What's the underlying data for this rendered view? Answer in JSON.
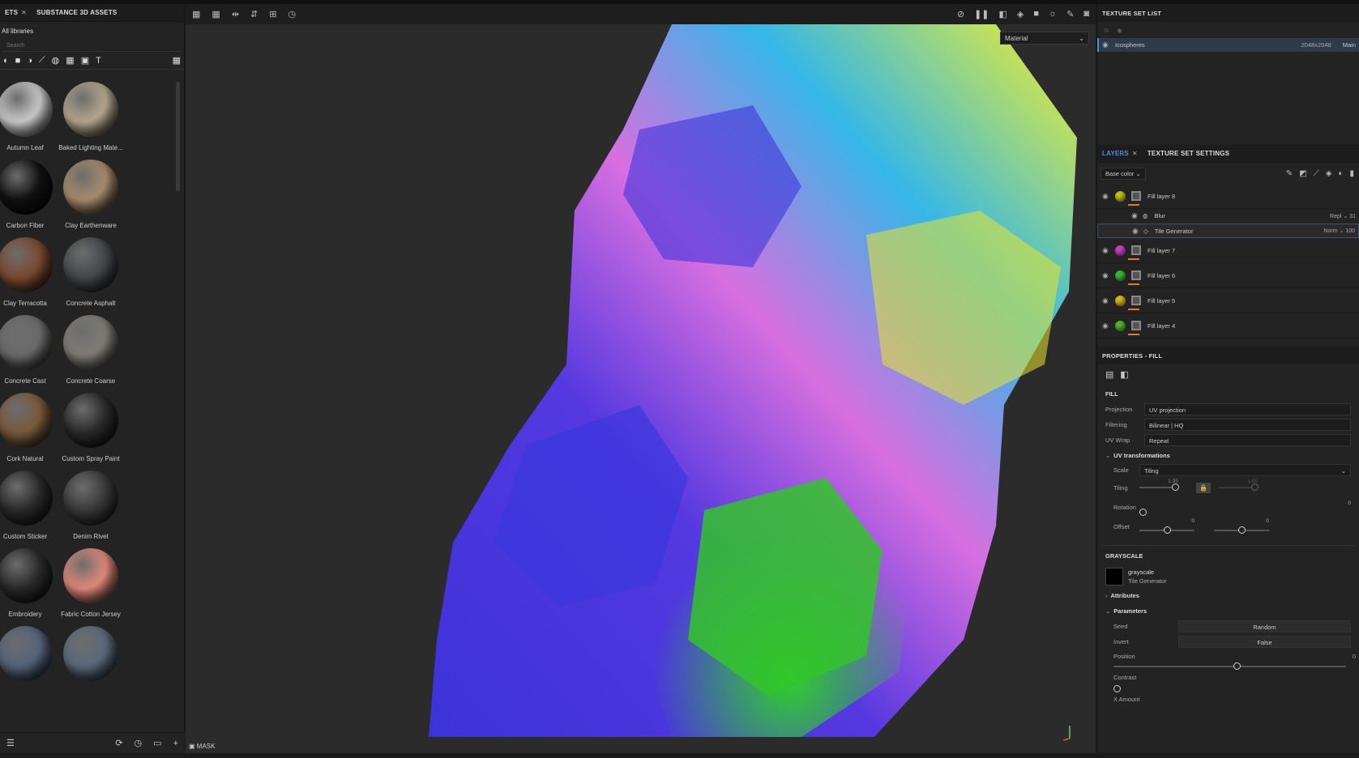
{
  "assets": {
    "tabs": [
      {
        "label": "ETS"
      },
      {
        "label": "SUBSTANCE 3D ASSETS"
      }
    ],
    "library": "All libraries",
    "search_placeholder": "Search",
    "items": [
      {
        "label": "Autumn Leaf",
        "color": "#c9c9c9"
      },
      {
        "label": "Baked Lighting Mate...",
        "color": "#b6a88e"
      },
      {
        "label": "Carbon Fiber",
        "color": "#111111"
      },
      {
        "label": "Clay Earthenware",
        "color": "#a98c6d"
      },
      {
        "label": "Clay Terracotta",
        "color": "#7a4a30"
      },
      {
        "label": "Concrete Asphalt",
        "color": "#45474b"
      },
      {
        "label": "Concrete Cast",
        "color": "#6b6b6b"
      },
      {
        "label": "Concrete Coarse",
        "color": "#7f7d75"
      },
      {
        "label": "Cork Natural",
        "color": "#7a5a3c"
      },
      {
        "label": "Custom Spray Paint",
        "color": "#2a2a2a"
      },
      {
        "label": "Custom Sticker",
        "color": "#2a2a2a"
      },
      {
        "label": "Denim Rivet",
        "color": "#3a3a3a"
      },
      {
        "label": "Embroidery",
        "color": "#2a2a2a"
      },
      {
        "label": "Fabric Cotton Jersey",
        "color": "#e08a78"
      },
      {
        "label": "",
        "color": "#55637a"
      },
      {
        "label": "",
        "color": "#5b6a7c"
      }
    ]
  },
  "viewport": {
    "material_select": "Material",
    "mask_label": "MASK"
  },
  "texture_set": {
    "title": "TEXTURE SET LIST",
    "name": "Icospheres",
    "resolution": "2048x2048",
    "shader": "Main"
  },
  "layers": {
    "tab_layers": "LAYERS",
    "tab_settings": "TEXTURE SET SETTINGS",
    "channel": "Base color",
    "items": [
      {
        "name": "Fill layer 8",
        "color": "#b8c41a"
      },
      {
        "name": "Fill layer 7",
        "color": "#c93fc0"
      },
      {
        "name": "Fill layer 6",
        "color": "#39b82f"
      },
      {
        "name": "Fill layer 5",
        "color": "#d6b51c"
      },
      {
        "name": "Fill layer 4",
        "color": "#4fb52a"
      }
    ],
    "effects": [
      {
        "name": "Blur",
        "blend": "Repl",
        "opacity": "31"
      },
      {
        "name": "Tile Generator",
        "blend": "Norm",
        "opacity": "100"
      }
    ]
  },
  "properties": {
    "title": "PROPERTIES - FILL",
    "fill_header": "FILL",
    "projection_label": "Projection",
    "projection": "UV projection",
    "filtering_label": "Filtering",
    "filtering": "Bilinear | HQ",
    "uvwrap_label": "UV Wrap",
    "uvwrap": "Repeat",
    "uv_transform": "UV transformations",
    "scale_label": "Scale",
    "scale": "Tiling",
    "tiling_label": "Tiling",
    "tiling_value": "1.95",
    "tiling_value2": "1.95",
    "rotation_label": "Rotation",
    "rotation_value": "0",
    "offset_label": "Offset",
    "offset_value": "0",
    "offset_value2": "0",
    "grayscale_header": "GRAYSCALE",
    "gs_name": "grayscale",
    "gs_source": "Tile Generator",
    "attributes": "Attributes",
    "parameters": "Parameters",
    "seed_label": "Seed",
    "seed": "Random",
    "invert_label": "Invert",
    "invert": "False",
    "position_label": "Position",
    "position_value": "0",
    "contrast_label": "Contrast",
    "xamount_label": "X Amount"
  }
}
